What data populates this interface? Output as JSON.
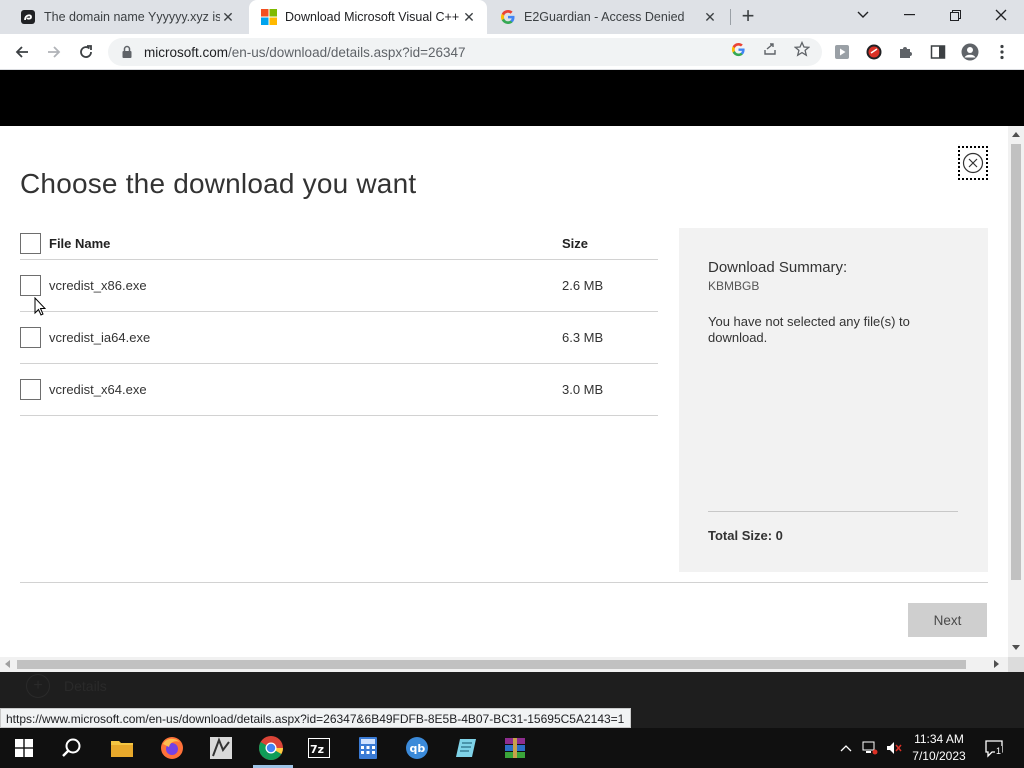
{
  "browser": {
    "tabs": [
      {
        "title": "The domain name Yyyyyy.xyz is av",
        "active": false,
        "favicon": "yyyyyy-favicon"
      },
      {
        "title": "Download Microsoft Visual C++",
        "active": true,
        "favicon": "microsoft-logo"
      },
      {
        "title": "E2Guardian - Access Denied",
        "active": false,
        "favicon": "google-g-logo"
      }
    ],
    "new_tab_label": "+",
    "url_domain": "microsoft.com",
    "url_path": "/en-us/download/details.aspx?id=26347",
    "status_url": "https://www.microsoft.com/en-us/download/details.aspx?id=26347&6B49FDFB-8E5B-4B07-BC31-15695C5A2143=1"
  },
  "dialog": {
    "title": "Choose the download you want",
    "table": {
      "headers": {
        "name": "File Name",
        "size": "Size"
      },
      "rows": [
        {
          "name": "vcredist_x86.exe",
          "size": "2.6 MB"
        },
        {
          "name": "vcredist_ia64.exe",
          "size": "6.3 MB"
        },
        {
          "name": "vcredist_x64.exe",
          "size": "3.0 MB"
        }
      ]
    },
    "summary": {
      "title": "Download Summary:",
      "code": "KBMBGB",
      "message": "You have not selected any file(s) to download.",
      "total": "Total Size: 0"
    },
    "next_label": "Next",
    "details_label": "Details"
  },
  "taskbar": {
    "apps": [
      "start-button",
      "search",
      "file-explorer",
      "firefox",
      "app-1",
      "chrome",
      "7zip",
      "calculator",
      "qbittorrent",
      "notepad",
      "winrar"
    ],
    "time": "11:34 AM",
    "date": "7/10/2023",
    "notification_count": "1"
  },
  "colors": {
    "header_black": "#000000",
    "summary_bg": "#f2f2f2",
    "next_button_bg": "#cfcfcf",
    "taskbar_bg": "#101010"
  }
}
